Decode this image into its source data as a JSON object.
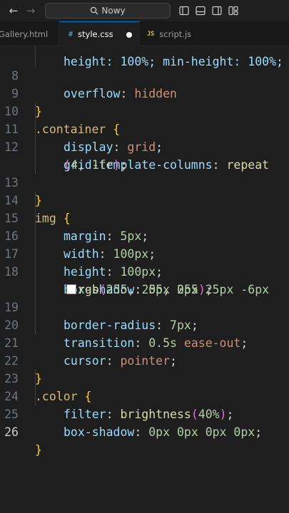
{
  "titlebar": {
    "back_icon": "arrow-left-icon",
    "forward_icon": "arrow-right-icon",
    "search_label": "Nowy"
  },
  "tabs": [
    {
      "label": "Gallery.html",
      "icon": ""
    },
    {
      "label": "style.css",
      "icon": "#",
      "modified": true
    },
    {
      "label": "script.js",
      "icon": "JS"
    }
  ],
  "editor": {
    "partial_top_line": "height: 100%; min-height: 100%;",
    "lines": [
      {
        "num": "8",
        "text": "overflow: hidden"
      },
      {
        "num": "9",
        "text": "}"
      },
      {
        "num": "10",
        "text": ".container {"
      },
      {
        "num": "11",
        "text": "display: grid;"
      },
      {
        "num": "12",
        "text": "grid-template-columns: repeat"
      },
      {
        "num": "",
        "text": "(4, 1fr);"
      },
      {
        "num": "13",
        "text": "}"
      },
      {
        "num": "14",
        "text": "img {"
      },
      {
        "num": "15",
        "text": "margin: 5px;"
      },
      {
        "num": "16",
        "text": "width: 100px;"
      },
      {
        "num": "17",
        "text": "height: 100px;"
      },
      {
        "num": "18",
        "text": "box-shadow: 0px 0px 25px -6px"
      },
      {
        "num": "",
        "text": "rgb(255, 255, 255);"
      },
      {
        "num": "19",
        "text": "border-radius: 7px;"
      },
      {
        "num": "20",
        "text": "transition: 0.5s ease-out;"
      },
      {
        "num": "21",
        "text": "cursor: pointer;"
      },
      {
        "num": "22",
        "text": "}"
      },
      {
        "num": "23",
        "text": ".color {"
      },
      {
        "num": "24",
        "text": "filter: brightness(40%);"
      },
      {
        "num": "25",
        "text": "box-shadow: 0px 0px 0px 0px;"
      },
      {
        "num": "26",
        "text": "}"
      }
    ]
  }
}
